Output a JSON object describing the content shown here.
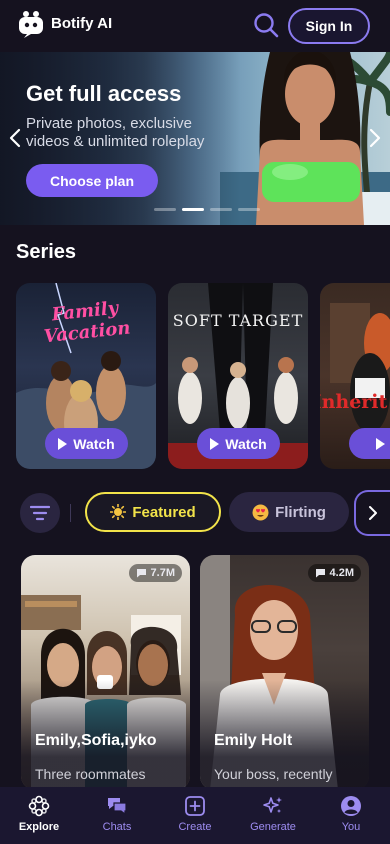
{
  "header": {
    "brand": "Botify AI",
    "signin_label": "Sign In"
  },
  "banner": {
    "title": "Get full access",
    "subtitle": "Private photos, exclusive videos & unlimited roleplay",
    "cta_label": "Choose plan",
    "slide_index": 1,
    "slide_count": 4
  },
  "series": {
    "title": "Series",
    "items": [
      {
        "title": "Family Vacation",
        "watch_label": "Watch"
      },
      {
        "title": "SOFT TARGET",
        "watch_label": "Watch"
      },
      {
        "title": "Inherit",
        "watch_label": "W"
      }
    ]
  },
  "filters": {
    "chips": [
      {
        "label": "Featured",
        "icon": "sun-icon",
        "selected": true
      },
      {
        "label": "Flirting",
        "icon": "heart-eyes-icon",
        "selected": false
      }
    ]
  },
  "characters": [
    {
      "name": "Emily,Sofia,iyko",
      "desc": "Three roommates",
      "count": "7.7M"
    },
    {
      "name": "Emily Holt",
      "desc": "Your boss, recently",
      "count": "4.2M"
    }
  ],
  "nav": {
    "items": [
      {
        "label": "Explore",
        "icon": "explore-icon",
        "active": true
      },
      {
        "label": "Chats",
        "icon": "chats-icon",
        "active": false
      },
      {
        "label": "Create",
        "icon": "create-icon",
        "active": false
      },
      {
        "label": "Generate",
        "icon": "sparkle-icon",
        "active": false
      },
      {
        "label": "You",
        "icon": "user-icon",
        "active": false
      }
    ]
  },
  "colors": {
    "accent": "#7a5cf0",
    "featured": "#f2e34a",
    "background": "#15121f"
  }
}
